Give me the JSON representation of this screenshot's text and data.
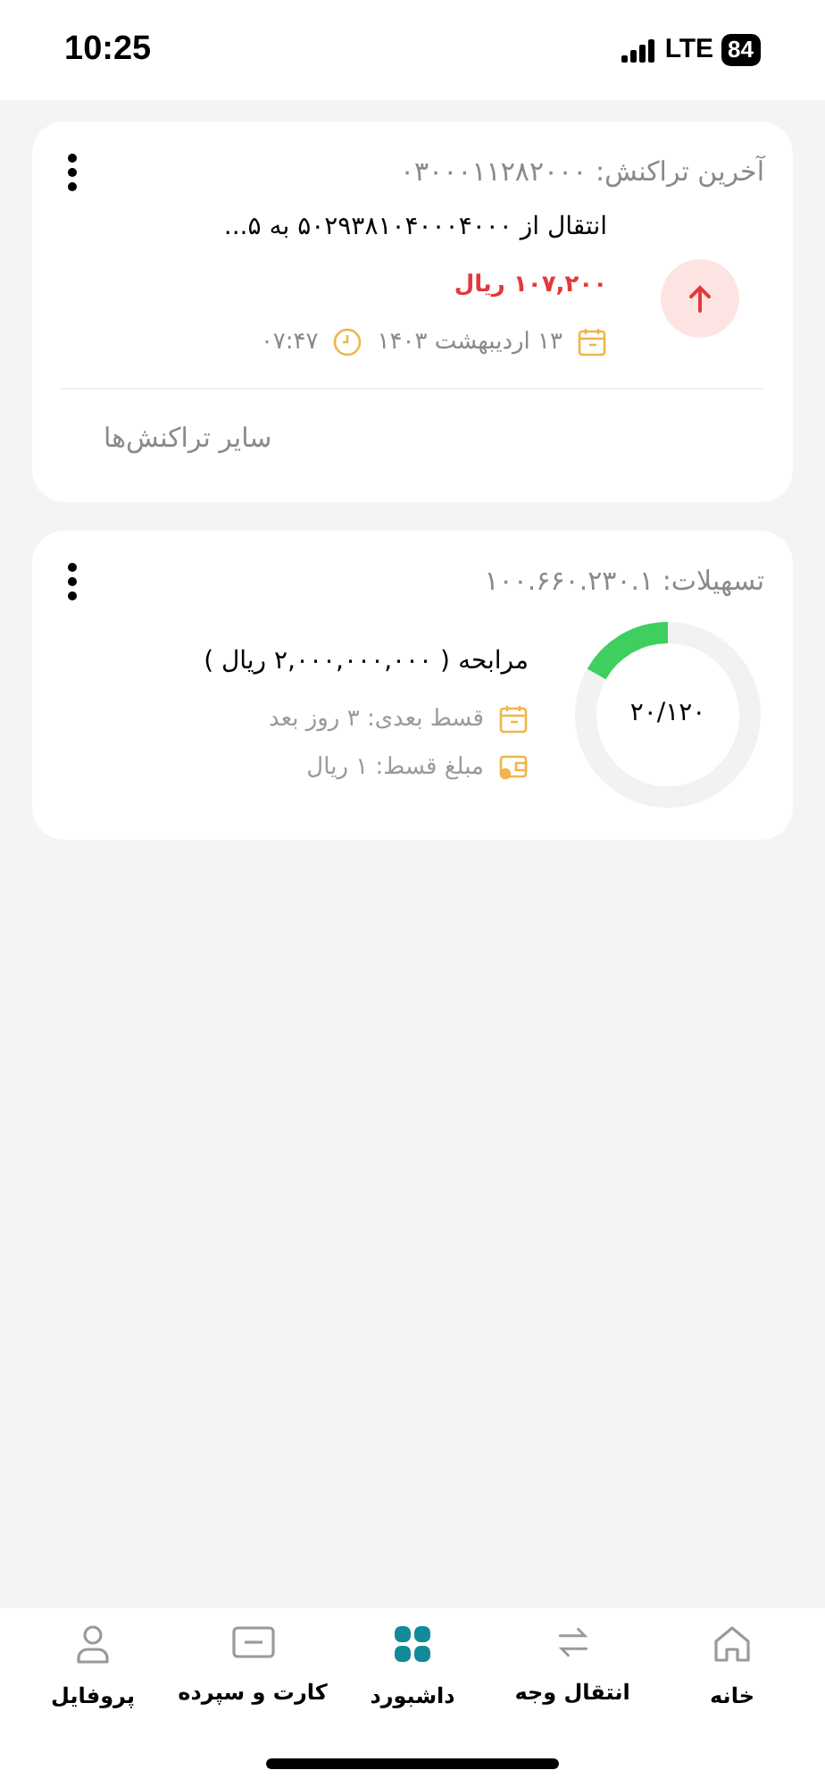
{
  "status_bar": {
    "time": "10:25",
    "network": "LTE",
    "battery": "84"
  },
  "last_transaction": {
    "title": "آخرین تراکنش: ۰۳۰۰۰۱۱۲۸۲۰۰۰",
    "description": "انتقال از ۵۰۲۹۳۸۱۰۴۰۰۰۴۰۰۰ به ۵...",
    "amount": "۱۰۷,۲۰۰ ریال",
    "date": "۱۳ اردیبهشت ۱۴۰۳",
    "time": "۰۷:۴۷",
    "more_link": "سایر تراکنش‌ها"
  },
  "loan": {
    "title": "تسهیلات: ۱۰۰.۶۶۰.۲۳۰.۱",
    "name": "مرابحه ( ۲,۰۰۰,۰۰۰,۰۰۰ ریال )",
    "next_installment": "قسط بعدی: ۳ روز بعد",
    "installment_amount": "مبلغ قسط: ۱ ریال",
    "progress_label": "۲۰/۱۲۰",
    "level": 0.167
  },
  "tab_bar": [
    {
      "label": "خانه",
      "selected": false
    },
    {
      "label": "انتقال وجه",
      "selected": false
    },
    {
      "label": "داشبورد",
      "selected": true
    },
    {
      "label": "کارت و سپرده",
      "selected": false
    },
    {
      "label": "پروفایل",
      "selected": false
    }
  ]
}
